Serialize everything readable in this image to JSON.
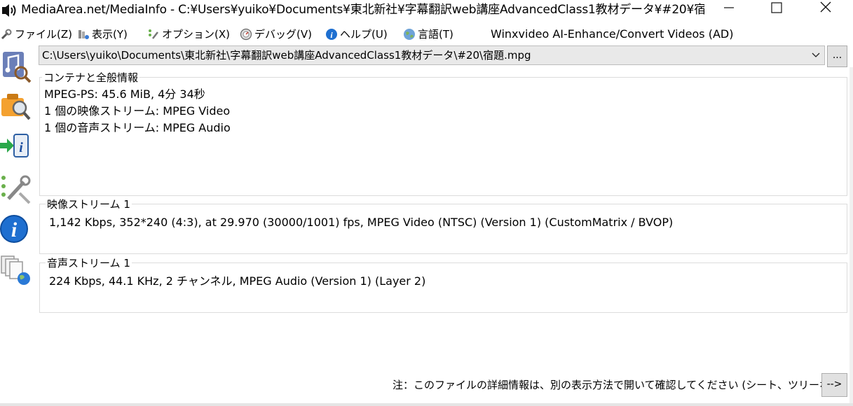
{
  "window": {
    "title": "MediaArea.net/MediaInfo - C:¥Users¥yuiko¥Documents¥東北新社¥字幕翻訳web講座AdvancedClass1教材データ¥#20¥宿..."
  },
  "menu": {
    "items": [
      {
        "label": "ファイル(Z)",
        "icon": "file-tools-icon"
      },
      {
        "label": "表示(Y)",
        "icon": "view-icon"
      },
      {
        "label": "オプション(X)",
        "icon": "options-icon"
      },
      {
        "label": "デバッグ(V)",
        "icon": "debug-icon"
      },
      {
        "label": "ヘルプ(U)",
        "icon": "help-icon"
      },
      {
        "label": "言語(T)",
        "icon": "globe-icon"
      }
    ],
    "extra": "Winxvideo AI-Enhance/Convert Videos (AD)"
  },
  "path": {
    "value": "C:\\Users\\yuiko\\Documents\\東北新社\\字幕翻訳web講座AdvancedClass1教材データ\\#20\\宿題.mpg",
    "browse_label": "..."
  },
  "sections": {
    "general": {
      "title": "コンテナと全般情報",
      "lines": [
        "MPEG-PS: 45.6 MiB, 4分 34秒",
        "1 個の映像ストリーム: MPEG Video",
        "1 個の音声ストリーム: MPEG Audio"
      ]
    },
    "video": {
      "title": "映像ストリーム 1",
      "line": "1,142 Kbps, 352*240 (4:3), at 29.970 (30000/1001) fps, MPEG Video (NTSC) (Version 1) (CustomMatrix / BVOP)"
    },
    "audio": {
      "title": "音声ストリーム 1",
      "line": "224 Kbps, 44.1 KHz, 2 チャンネル, MPEG Audio (Version 1) (Layer 2)"
    }
  },
  "footer": {
    "note": "注：このファイルの詳細情報は、別の表示方法で開いて確認してください (シート、ツリーなど)",
    "next_label": "-->"
  },
  "colors": {
    "accent_blue": "#1e6fd0",
    "border": "#dcdcdc"
  }
}
